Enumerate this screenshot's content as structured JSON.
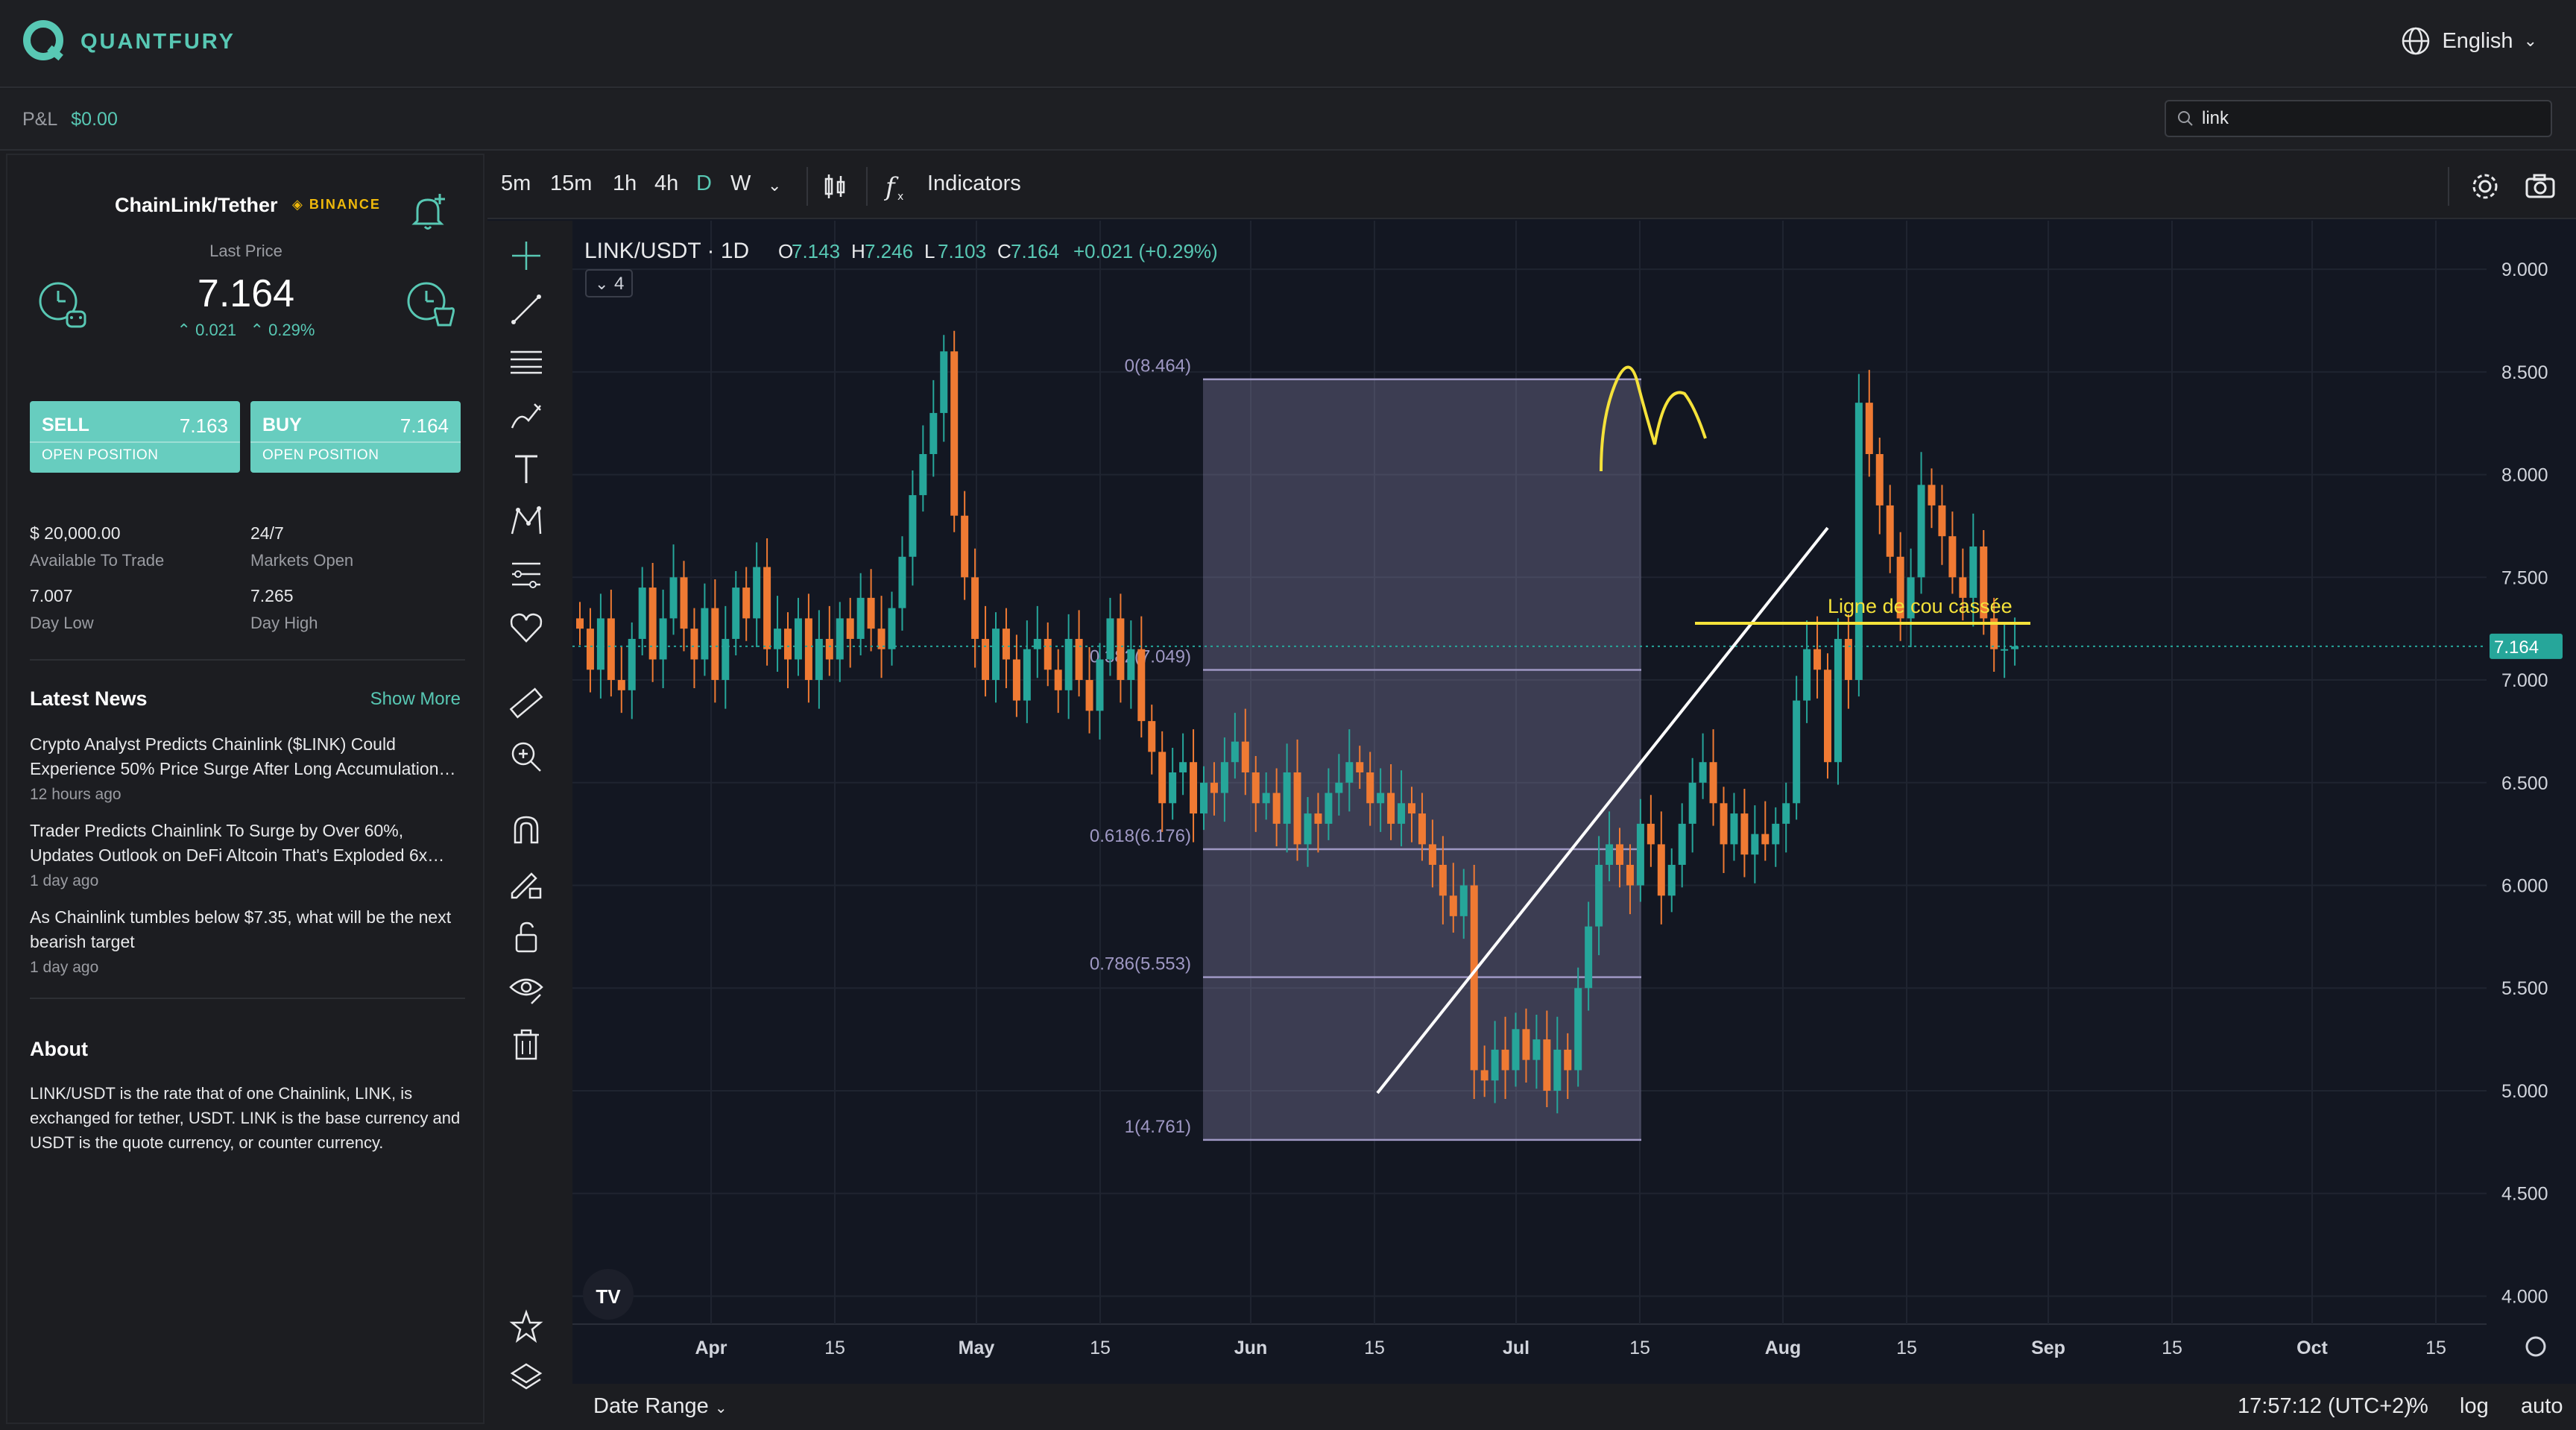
{
  "app": {
    "brand": "QUANTFURY",
    "language": "English"
  },
  "pnl": {
    "label": "P&L",
    "value": "$0.00"
  },
  "search": {
    "value": "link"
  },
  "instrument": {
    "name": "ChainLink/Tether",
    "exchange": "BINANCE",
    "last_price_label": "Last Price",
    "last_price": "7.164",
    "change_abs": "0.021",
    "change_pct": "0.29%"
  },
  "trade": {
    "sell": {
      "label": "SELL",
      "price": "7.163",
      "sub": "OPEN POSITION"
    },
    "buy": {
      "label": "BUY",
      "price": "7.164",
      "sub": "OPEN POSITION"
    }
  },
  "stats": [
    {
      "value": "$ 20,000.00",
      "label": "Available To Trade"
    },
    {
      "value": "24/7",
      "label": "Markets Open"
    },
    {
      "value": "7.007",
      "label": "Day Low"
    },
    {
      "value": "7.265",
      "label": "Day High"
    }
  ],
  "news": {
    "title": "Latest News",
    "show_more": "Show More",
    "items": [
      {
        "title": "Crypto Analyst Predicts Chainlink ($LINK) Could Experience 50% Price Surge After Long Accumulation…",
        "time": "12 hours ago"
      },
      {
        "title": "Trader Predicts Chainlink To Surge by Over 60%, Updates Outlook on DeFi Altcoin That's Exploded 6x…",
        "time": "1 day ago"
      },
      {
        "title": "As Chainlink tumbles below $7.35, what will be the next bearish target",
        "time": "1 day ago"
      }
    ]
  },
  "about": {
    "title": "About",
    "text": "LINK/USDT is the rate that of one Chainlink, LINK, is exchanged for tether, USDT. LINK is the base currency and USDT is the quote currency, or counter currency."
  },
  "toolbar": {
    "timeframes": [
      "5m",
      "15m",
      "1h",
      "4h",
      "D",
      "W"
    ],
    "active_timeframe": "D",
    "indicators": "Indicators"
  },
  "legend": {
    "symbol": "LINK/USDT · 1D",
    "o_label": "O",
    "o": "7.143",
    "h_label": "H",
    "h": "7.246",
    "l_label": "L",
    "l": "7.103",
    "c_label": "C",
    "c": "7.164",
    "change": "+0.021 (+0.29%)",
    "collapsed_count": "4"
  },
  "bottom": {
    "date_range": "Date Range",
    "clock": "17:57:12 (UTC+2)",
    "pct": "%",
    "log": "log",
    "auto": "auto"
  },
  "colors": {
    "up": "#26a69a",
    "down": "#ef7a33",
    "accent": "#58c8b4",
    "annotation": "#f5e23a",
    "fib": "#9f98c4"
  },
  "chart_data": {
    "type": "candlestick",
    "title": "LINK/USDT · 1D",
    "y_ticks": [
      9.0,
      8.5,
      8.0,
      7.5,
      7.0,
      6.5,
      6.0,
      5.5,
      5.0,
      4.5,
      4.0
    ],
    "y_tick_labels": [
      "9.000",
      "8.500",
      "8.000",
      "7.500",
      "7.000",
      "6.500",
      "6.000",
      "5.500",
      "5.000",
      "4.500",
      "4.000"
    ],
    "ylim": [
      3.9,
      9.2
    ],
    "x_tick_labels": [
      "Apr",
      "15",
      "May",
      "15",
      "Jun",
      "15",
      "Jul",
      "15",
      "Aug",
      "15",
      "Sep",
      "15",
      "Oct",
      "15"
    ],
    "last_price_label": "7.164",
    "last_price": 7.164,
    "fib_levels": [
      {
        "label": "0(8.464)",
        "value": 8.464
      },
      {
        "label": "0.382(7.049)",
        "value": 7.049
      },
      {
        "label": "0.618(6.176)",
        "value": 6.176
      },
      {
        "label": "0.786(5.553)",
        "value": 5.553
      },
      {
        "label": "1(4.761)",
        "value": 4.761
      }
    ],
    "annotation": "Ligne de cou cassée",
    "close_series": [
      7.25,
      7.05,
      7.3,
      7.0,
      6.95,
      7.2,
      7.45,
      7.1,
      7.3,
      7.5,
      7.25,
      7.1,
      7.35,
      7.0,
      7.2,
      7.45,
      7.3,
      7.55,
      7.15,
      7.25,
      7.1,
      7.3,
      7.0,
      7.2,
      7.1,
      7.3,
      7.2,
      7.4,
      7.25,
      7.15,
      7.35,
      7.6,
      7.9,
      8.1,
      8.3,
      8.6,
      7.8,
      7.5,
      7.2,
      7.0,
      7.25,
      7.1,
      6.9,
      7.15,
      7.2,
      7.05,
      6.95,
      7.2,
      7.0,
      6.85,
      7.1,
      7.3,
      7.0,
      7.15,
      6.8,
      6.65,
      6.4,
      6.55,
      6.6,
      6.35,
      6.5,
      6.45,
      6.6,
      6.7,
      6.55,
      6.4,
      6.45,
      6.3,
      6.55,
      6.2,
      6.35,
      6.3,
      6.45,
      6.5,
      6.6,
      6.55,
      6.4,
      6.45,
      6.3,
      6.4,
      6.35,
      6.2,
      6.1,
      5.95,
      5.85,
      6.0,
      5.1,
      5.05,
      5.2,
      5.1,
      5.3,
      5.15,
      5.25,
      5.0,
      5.2,
      5.1,
      5.5,
      5.8,
      6.1,
      6.2,
      6.1,
      6.0,
      6.3,
      6.2,
      5.95,
      6.1,
      6.3,
      6.5,
      6.6,
      6.4,
      6.2,
      6.35,
      6.15,
      6.25,
      6.2,
      6.3,
      6.4,
      6.9,
      7.15,
      7.05,
      6.6,
      7.2,
      7.0,
      8.35,
      8.1,
      7.85,
      7.6,
      7.3,
      7.5,
      7.95,
      7.85,
      7.7,
      7.5,
      7.4,
      7.65,
      7.3,
      7.15,
      7.15,
      7.164
    ]
  }
}
